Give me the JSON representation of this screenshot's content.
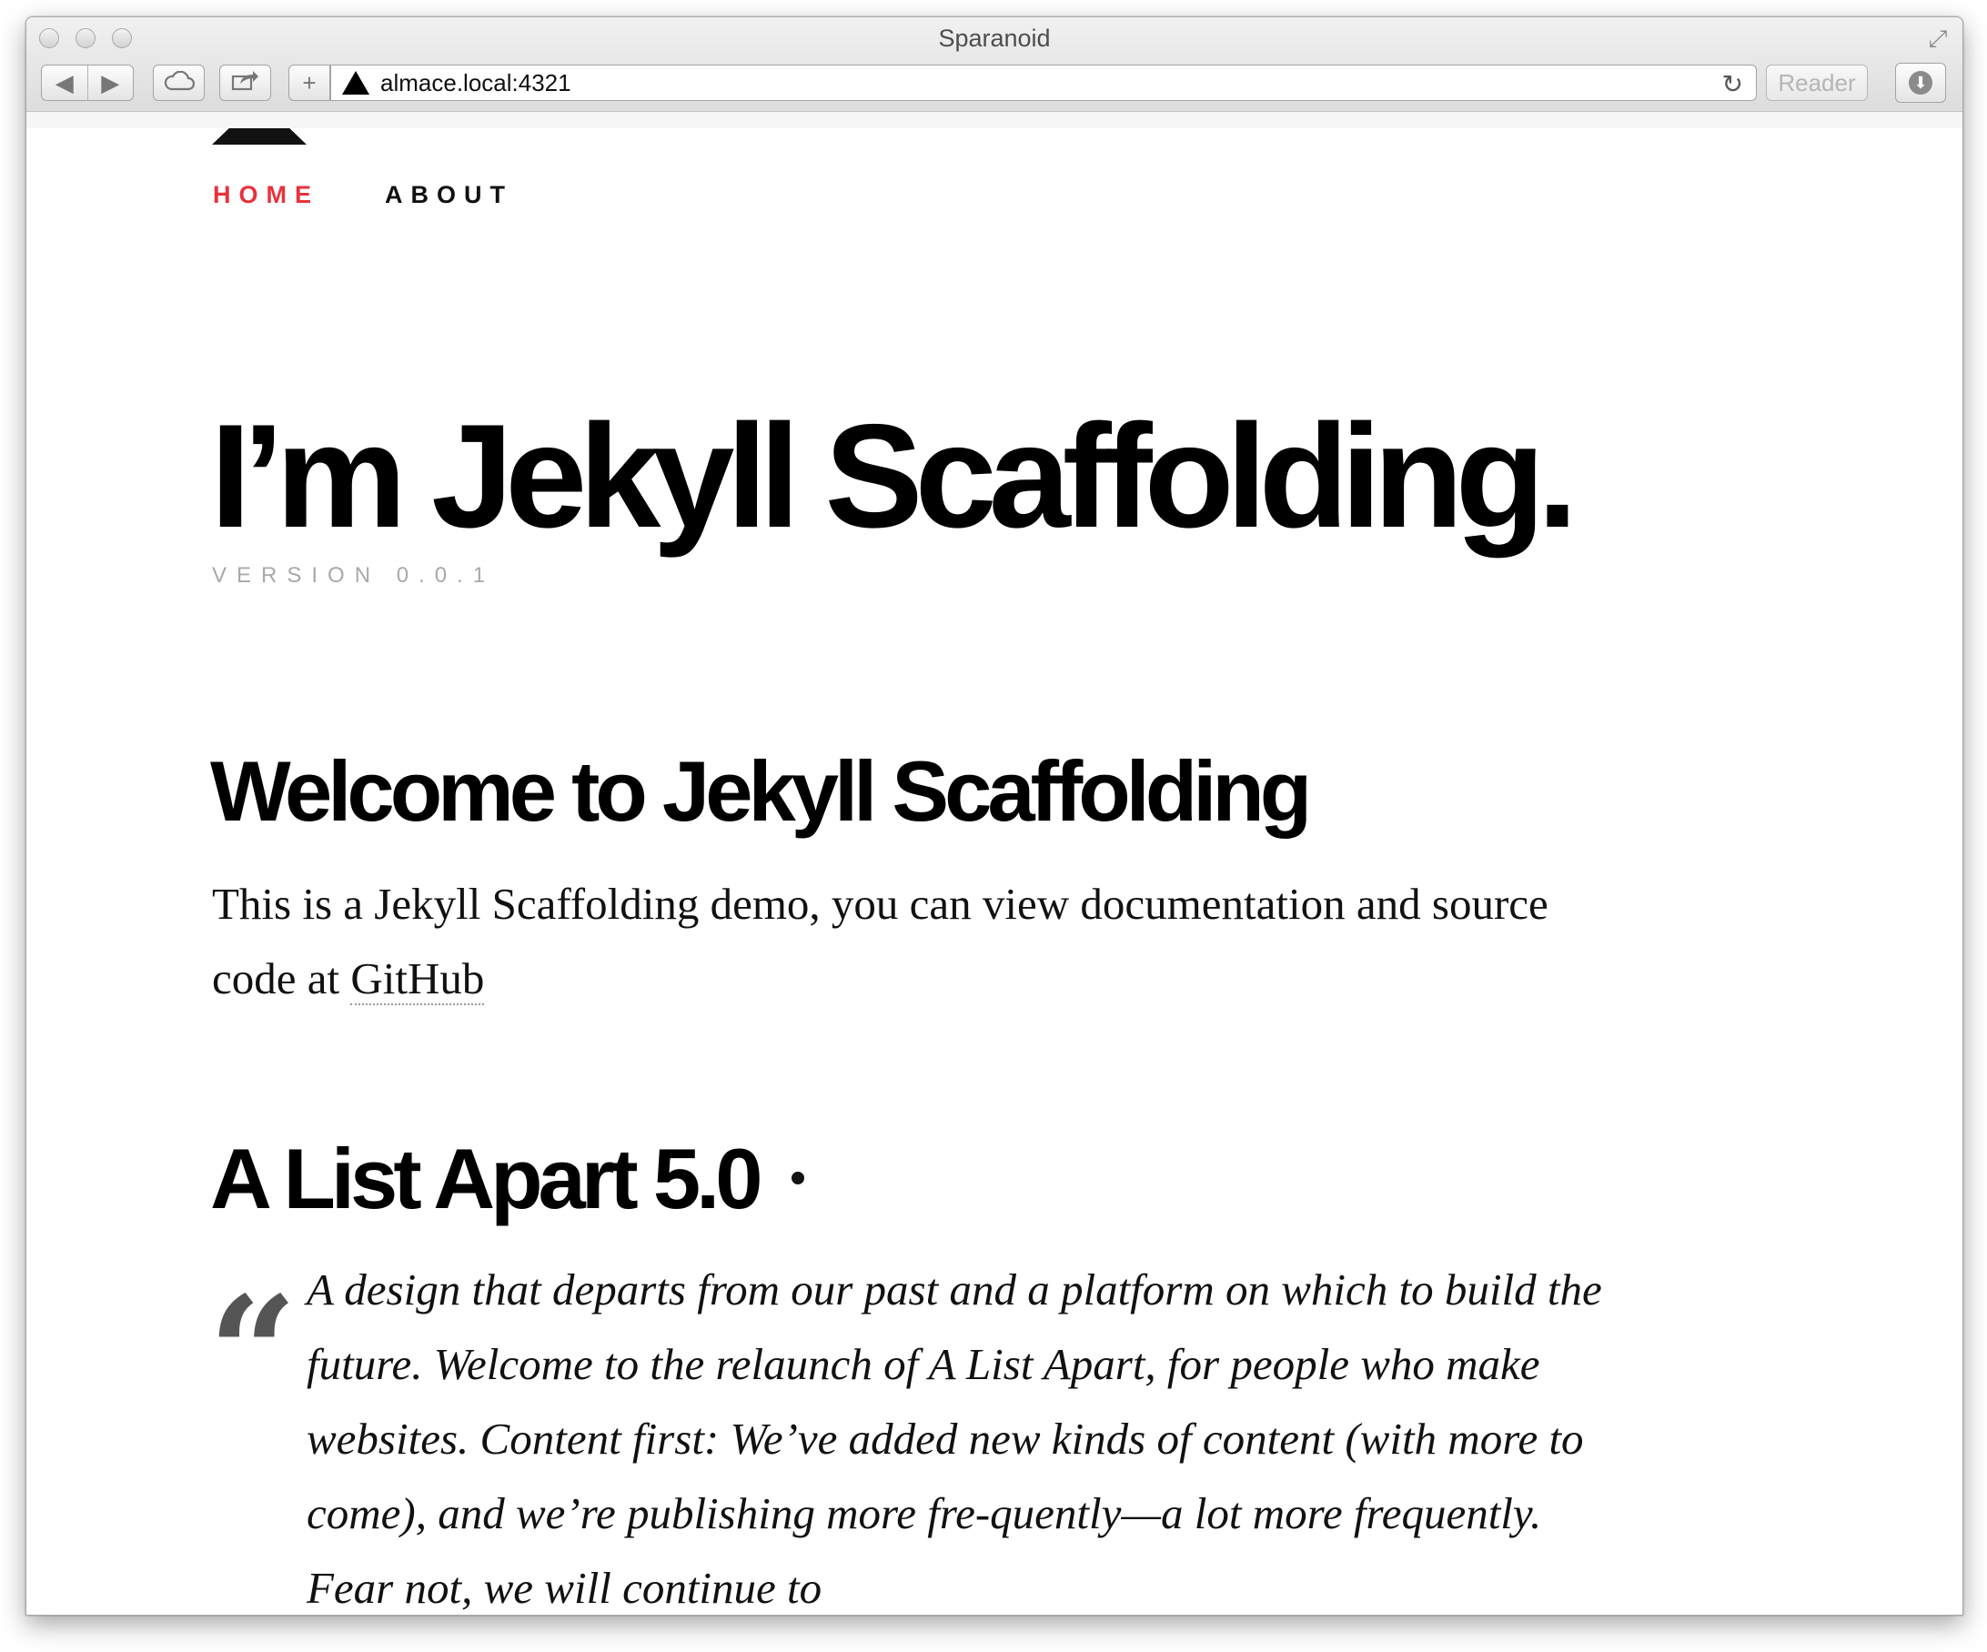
{
  "browser": {
    "window_title": "Sparanoid",
    "url": "almace.local:4321",
    "reader_label": "Reader",
    "back_icon": "back-arrow-icon",
    "forward_icon": "forward-arrow-icon",
    "cloud_icon": "icloud-tabs-icon",
    "share_icon": "share-icon",
    "new_tab_icon": "plus-icon",
    "reload_icon": "reload-icon",
    "download_icon": "downloads-icon"
  },
  "nav": {
    "home": "HOME",
    "about": "ABOUT",
    "active_color": "#e8323c"
  },
  "hero": {
    "title": "I’m Jekyll Scaffolding.",
    "version": "VERSION 0.0.1"
  },
  "welcome": {
    "heading": "Welcome to Jekyll Scaffolding",
    "body_prefix": "This is a Jekyll Scaffolding demo, you can view documentation and source code at ",
    "link_text": "GitHub"
  },
  "post": {
    "title": "A List Apart 5.0",
    "quote": "A design that departs from our past and a platform on which to build the future. Welcome to the relaunch of A List Apart, for people who make websites. Content first: We’ve added new kinds of content (with more to come), and we’re publishing more fre-quently—a lot more frequently. Fear not, we will continue to"
  }
}
